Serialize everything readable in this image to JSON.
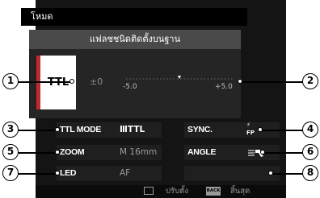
{
  "header": {
    "mode_label": "โหมด"
  },
  "flash_panel": {
    "title": "แฟลชชนิดติดตั้งบนฐาน",
    "mode": "TTL",
    "compensation": "±0",
    "scale_min": "-5.0",
    "scale_max": "+5.0"
  },
  "settings": {
    "ttl_mode": {
      "label": "TTL MODE",
      "value": "ⅢTTL"
    },
    "sync": {
      "label": "SYNC.",
      "icon": "sync-fp-icon",
      "value": "FP"
    },
    "zoom": {
      "label": "ZOOM",
      "value": "M 16mm"
    },
    "angle": {
      "label": "ANGLE",
      "icon": "angle-icon"
    },
    "led": {
      "label": "LED",
      "value": "AF"
    }
  },
  "footer": {
    "adjust_icon": "menu-icon",
    "adjust_label": "ปรับตั้ง",
    "back_icon": "back-icon",
    "back_key": "BACK",
    "end_label": "สิ้นสุด"
  },
  "callouts": [
    "1",
    "2",
    "3",
    "4",
    "5",
    "6",
    "7",
    "8"
  ],
  "colors": {
    "accent": "#c0282f",
    "background": "#141414"
  }
}
